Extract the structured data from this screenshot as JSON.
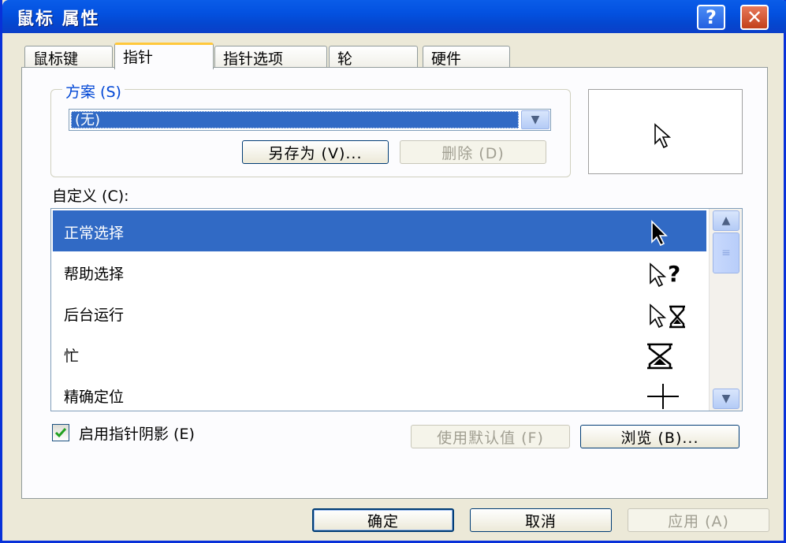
{
  "window": {
    "title": "鼠标 属性",
    "help_glyph": "?",
    "close_glyph": "✕"
  },
  "tabs": [
    {
      "label": "鼠标键"
    },
    {
      "label": "指针",
      "active": true
    },
    {
      "label": "指针选项"
    },
    {
      "label": "轮"
    },
    {
      "label": "硬件"
    }
  ],
  "scheme": {
    "legend": "方案 (S)",
    "selected": "(无)",
    "save_as": "另存为 (V)...",
    "delete": "删除 (D)"
  },
  "custom": {
    "label": "自定义 (C):",
    "items": [
      {
        "label": "正常选择",
        "icon": "arrow-cursor-icon"
      },
      {
        "label": "帮助选择",
        "icon": "help-cursor-icon"
      },
      {
        "label": "后台运行",
        "icon": "working-cursor-icon"
      },
      {
        "label": "忙",
        "icon": "hourglass-icon"
      },
      {
        "label": "精确定位",
        "icon": "crosshair-icon"
      }
    ]
  },
  "shadow": {
    "label": "启用指针阴影 (E)",
    "checked": true
  },
  "buttons": {
    "use_default": "使用默认值 (F)",
    "browse": "浏览 (B)...",
    "ok": "确定",
    "cancel": "取消",
    "apply": "应用 (A)"
  },
  "colors": {
    "selection": "#316ac5",
    "titlebar": "#0351e0",
    "group_legend": "#0046d5",
    "active_tab_highlight": "#ffc83c"
  }
}
